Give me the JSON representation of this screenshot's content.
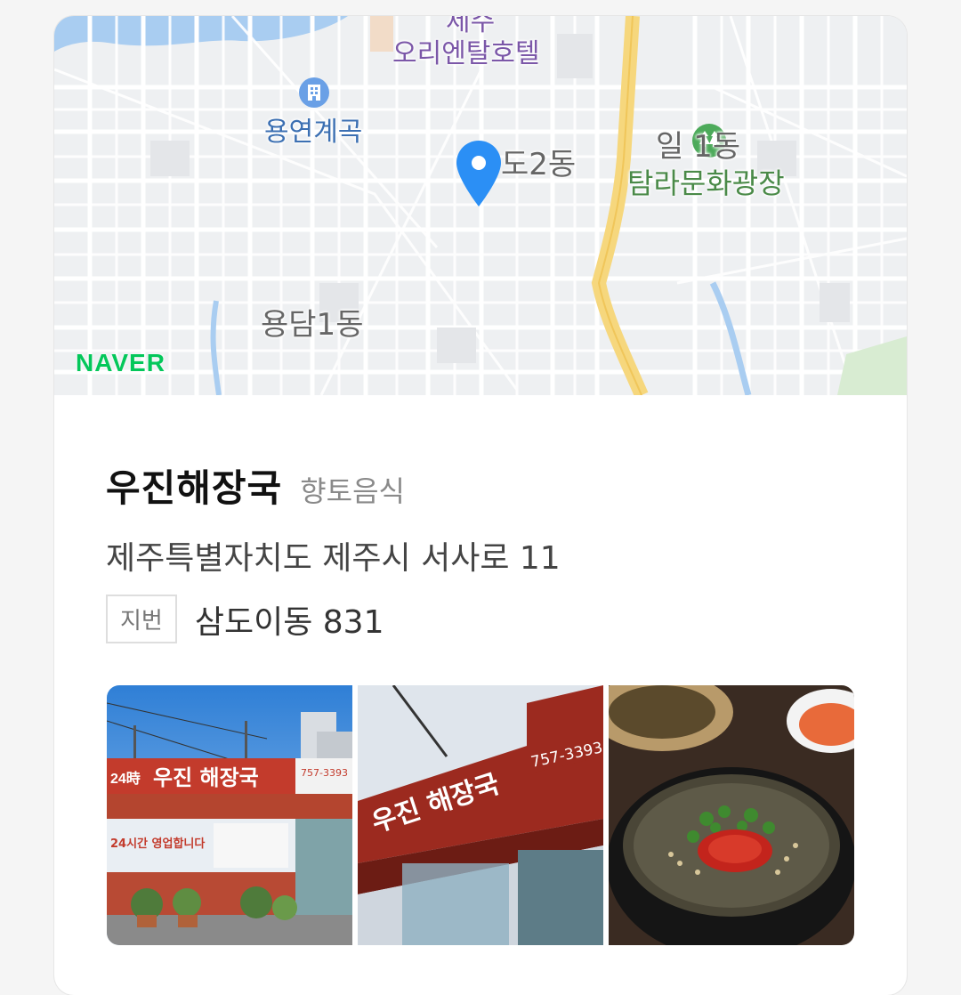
{
  "map": {
    "labels": {
      "hotel_line1": "제주",
      "hotel_line2": "오리엔탈호텔",
      "valley": "용연계곡",
      "district_center": "도2동",
      "district_right": "일 1동",
      "park": "탐라문화광장",
      "district_bottom": "용담1동"
    },
    "provider_logo": "NAVER",
    "colors": {
      "road_main": "#f6d77d",
      "water": "#a9cdf1",
      "pin": "#2b8ff5",
      "park": "#4a8a48",
      "hotel": "#7b57a8",
      "naver": "#03c75a"
    },
    "icons": [
      "location-pin-icon",
      "building-icon",
      "tree-icon"
    ]
  },
  "place": {
    "name": "우진해장국",
    "category": "향토음식",
    "road_address": "제주특별자치도 제주시 서사로 11",
    "jibun_label": "지번",
    "jibun_address": "삼도이동 831"
  },
  "photos": {
    "storefront_sign": "우진 해장국",
    "storefront_hours": "24시간 영업합니다",
    "storefront_phone": "757-3393",
    "closeup_sign": "우진 해장국",
    "closeup_phone": "757-3393"
  }
}
